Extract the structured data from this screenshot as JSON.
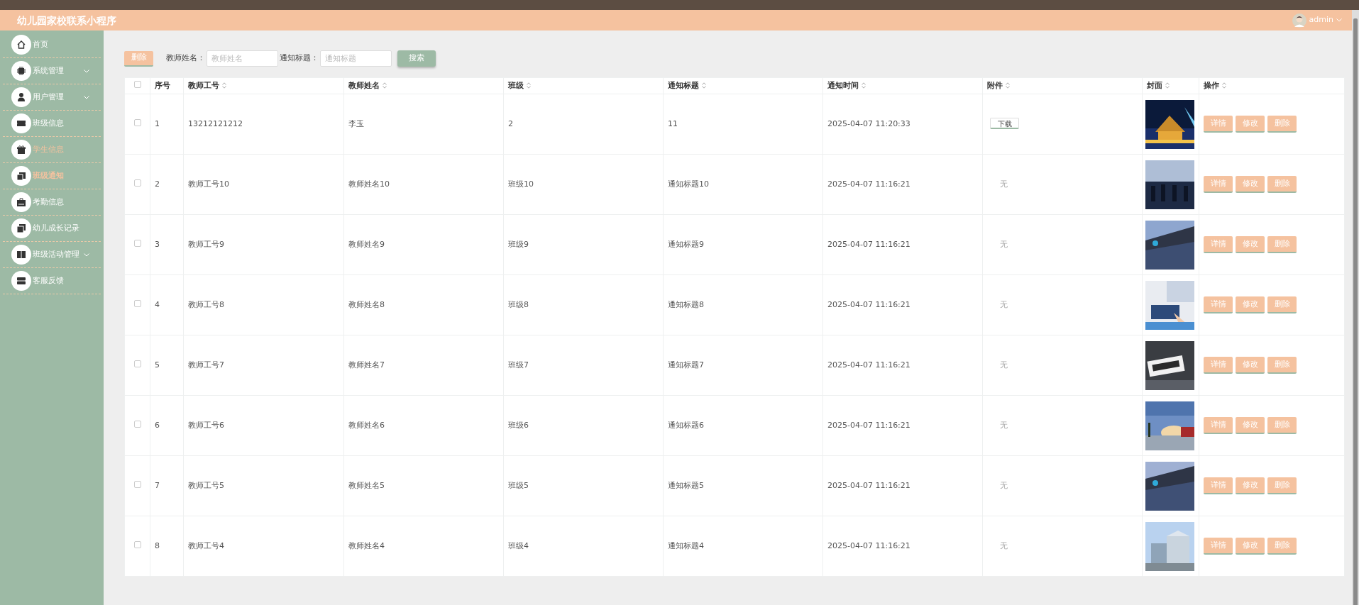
{
  "header": {
    "title": "幼儿园家校联系小程序",
    "user": "admin"
  },
  "sidebar": {
    "items": [
      {
        "label": "首页",
        "has_submenu": false,
        "selected": false,
        "hovered": false
      },
      {
        "label": "系统管理",
        "has_submenu": true,
        "selected": false,
        "hovered": false
      },
      {
        "label": "用户管理",
        "has_submenu": true,
        "selected": false,
        "hovered": false
      },
      {
        "label": "班级信息",
        "has_submenu": false,
        "selected": false,
        "hovered": false
      },
      {
        "label": "学生信息",
        "has_submenu": false,
        "selected": false,
        "hovered": true
      },
      {
        "label": "班级通知",
        "has_submenu": false,
        "selected": true,
        "hovered": false
      },
      {
        "label": "考勤信息",
        "has_submenu": false,
        "selected": false,
        "hovered": false
      },
      {
        "label": "幼儿成长记录",
        "has_submenu": false,
        "selected": false,
        "hovered": false
      },
      {
        "label": "班级活动管理",
        "has_submenu": true,
        "selected": false,
        "hovered": false
      },
      {
        "label": "客服反馈",
        "has_submenu": false,
        "selected": false,
        "hovered": false
      }
    ]
  },
  "toolbar": {
    "delete_button": "删除",
    "filters": [
      {
        "label": "教师姓名：",
        "placeholder": "教师姓名"
      },
      {
        "label": "通知标题：",
        "placeholder": "通知标题"
      }
    ],
    "search_button": "搜索"
  },
  "table": {
    "header_checked": false,
    "columns": [
      {
        "label": "序号",
        "sortable": false
      },
      {
        "label": "教师工号",
        "sortable": true
      },
      {
        "label": "教师姓名",
        "sortable": true
      },
      {
        "label": "班级",
        "sortable": true
      },
      {
        "label": "通知标题",
        "sortable": true
      },
      {
        "label": "通知时间",
        "sortable": true
      },
      {
        "label": "附件",
        "sortable": true
      },
      {
        "label": "封面",
        "sortable": true
      },
      {
        "label": "操作",
        "sortable": true
      }
    ],
    "rows": [
      {
        "checked": false,
        "no": "1",
        "teacher_id": "13212121212",
        "teacher_name": "李玉",
        "class": "2",
        "title": "11",
        "time": "2025-04-07 11:20:33",
        "attachment": {
          "kind": "download",
          "text": "下载"
        },
        "actions": [
          "详情",
          "修改",
          "删除"
        ]
      },
      {
        "checked": false,
        "no": "2",
        "teacher_id": "教师工号10",
        "teacher_name": "教师姓名10",
        "class": "班级10",
        "title": "通知标题10",
        "time": "2025-04-07 11:16:21",
        "attachment": {
          "kind": "none",
          "text": "无"
        },
        "actions": [
          "详情",
          "修改",
          "删除"
        ]
      },
      {
        "checked": false,
        "no": "3",
        "teacher_id": "教师工号9",
        "teacher_name": "教师姓名9",
        "class": "班级9",
        "title": "通知标题9",
        "time": "2025-04-07 11:16:21",
        "attachment": {
          "kind": "none",
          "text": "无"
        },
        "actions": [
          "详情",
          "修改",
          "删除"
        ]
      },
      {
        "checked": false,
        "no": "4",
        "teacher_id": "教师工号8",
        "teacher_name": "教师姓名8",
        "class": "班级8",
        "title": "通知标题8",
        "time": "2025-04-07 11:16:21",
        "attachment": {
          "kind": "none",
          "text": "无"
        },
        "actions": [
          "详情",
          "修改",
          "删除"
        ]
      },
      {
        "checked": false,
        "no": "5",
        "teacher_id": "教师工号7",
        "teacher_name": "教师姓名7",
        "class": "班级7",
        "title": "通知标题7",
        "time": "2025-04-07 11:16:21",
        "attachment": {
          "kind": "none",
          "text": "无"
        },
        "actions": [
          "详情",
          "修改",
          "删除"
        ]
      },
      {
        "checked": false,
        "no": "6",
        "teacher_id": "教师工号6",
        "teacher_name": "教师姓名6",
        "class": "班级6",
        "title": "通知标题6",
        "time": "2025-04-07 11:16:21",
        "attachment": {
          "kind": "none",
          "text": "无"
        },
        "actions": [
          "详情",
          "修改",
          "删除"
        ]
      },
      {
        "checked": false,
        "no": "7",
        "teacher_id": "教师工号5",
        "teacher_name": "教师姓名5",
        "class": "班级5",
        "title": "通知标题5",
        "time": "2025-04-07 11:16:21",
        "attachment": {
          "kind": "none",
          "text": "无"
        },
        "actions": [
          "详情",
          "修改",
          "删除"
        ]
      },
      {
        "checked": false,
        "no": "8",
        "teacher_id": "教师工号4",
        "teacher_name": "教师姓名4",
        "class": "班级4",
        "title": "通知标题4",
        "time": "2025-04-07 11:16:21",
        "attachment": {
          "kind": "none",
          "text": "无"
        },
        "actions": [
          "详情",
          "修改",
          "删除"
        ]
      }
    ]
  }
}
